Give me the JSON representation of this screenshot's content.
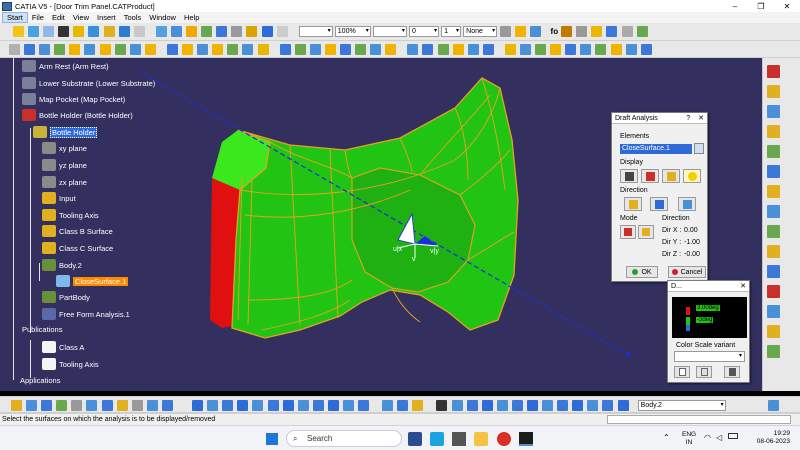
{
  "window": {
    "title": "CATIA V5 - [Door Trim Panel.CATProduct]",
    "minimize": "–",
    "restore": "❐",
    "close": "✕"
  },
  "menu": [
    "Start",
    "File",
    "Edit",
    "View",
    "Insert",
    "Tools",
    "Window",
    "Help"
  ],
  "toolbar": {
    "zoom_value": "100%",
    "layer_value": "None",
    "dash_value": "0",
    "one_value": "1",
    "fog_label": "fo"
  },
  "tree": {
    "items": [
      {
        "label": "Arm Rest (Arm Rest)"
      },
      {
        "label": "Lower Substrate (Lower Substrate)"
      },
      {
        "label": "Map Pocket (Map Pocket)"
      },
      {
        "label": "Bottle Holder (Bottle Holder)"
      },
      {
        "label": "Bottle Holder"
      },
      {
        "label": "xy plane"
      },
      {
        "label": "yz plane"
      },
      {
        "label": "zx plane"
      },
      {
        "label": "Input"
      },
      {
        "label": "Tooling Axis"
      },
      {
        "label": "Class B Surface"
      },
      {
        "label": "Class C Surface"
      },
      {
        "label": "Body.2"
      },
      {
        "label": "CloseSurface.1"
      },
      {
        "label": "PartBody"
      },
      {
        "label": "Free Form Analysis.1"
      },
      {
        "label": "Publications"
      },
      {
        "label": "Class A"
      },
      {
        "label": "Tooling Axis"
      },
      {
        "label": "Applications"
      }
    ]
  },
  "compass": {
    "u": "u|x",
    "v": "v",
    "w": "v|y"
  },
  "draft_dialog": {
    "title": "Draft Analysis",
    "help": "?",
    "close": "✕",
    "elements_label": "Elements",
    "elements_value": "CloseSurface.1",
    "display_label": "Display",
    "direction_label": "Direction",
    "mode_label": "Mode",
    "direction_group_label": "Direction",
    "dir_x_label": "Dir X :",
    "dir_x_value": "0.00",
    "dir_y_label": "Dir Y :",
    "dir_y_value": "-1.00",
    "dir_z_label": "Dir Z :",
    "dir_z_value": "-0.00",
    "ok_label": "OK",
    "cancel_label": "Cancel"
  },
  "color_dialog": {
    "title": "D...",
    "close": "✕",
    "scale_labels": [
      "3.00deg",
      "-3deg"
    ],
    "variant_label": "Color Scale variant"
  },
  "bottom_toolbar": {
    "body_combo": "Body.2"
  },
  "status": {
    "text": "Select the surfaces on which the analysis is to be displayed/removed"
  },
  "taskbar": {
    "search_placeholder": "Search",
    "lang": "ENG",
    "region": "IN",
    "time": "19:29",
    "date": "08-06-2023"
  },
  "colors": {
    "viewport_bg": "#33305f",
    "surface_green": "#22c414",
    "edge_orange": "#e8a020",
    "draft_red": "#e01010",
    "selection_blue": "#2f6bd6"
  }
}
